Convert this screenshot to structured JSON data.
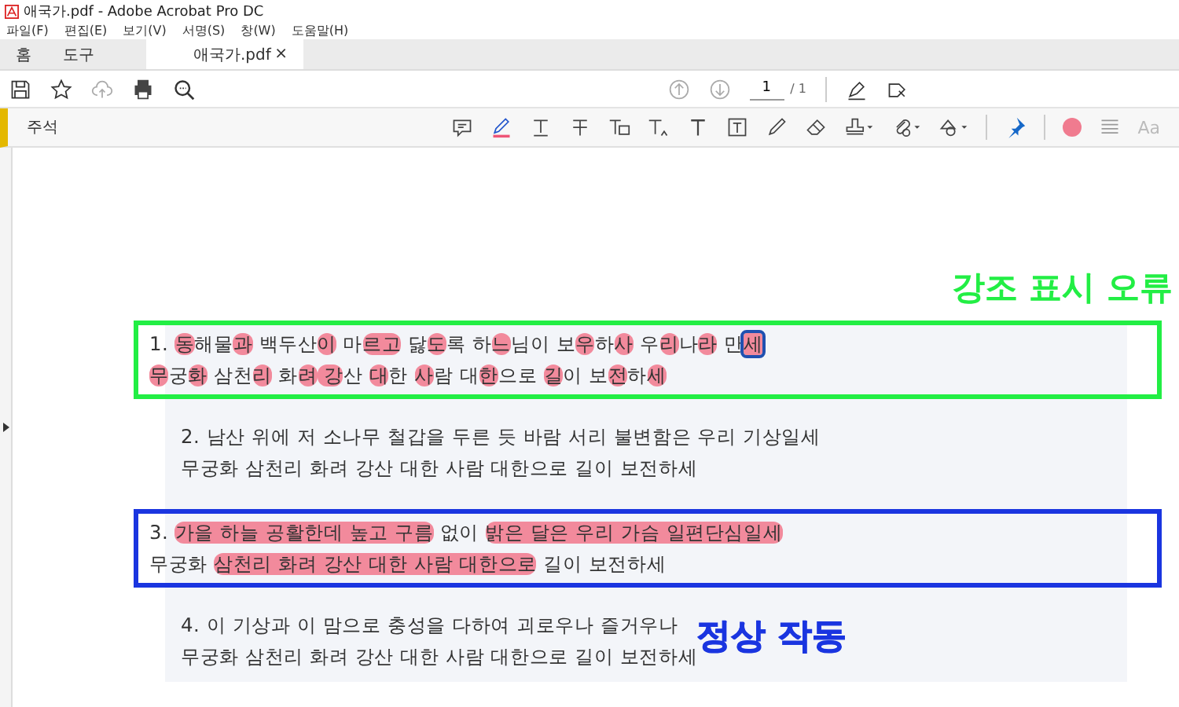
{
  "window": {
    "title": "애국가.pdf - Adobe Acrobat Pro DC"
  },
  "menu": [
    "파일(F)",
    "편집(E)",
    "보기(V)",
    "서명(S)",
    "창(W)",
    "도움말(H)"
  ],
  "tabs": [
    {
      "label": "홈",
      "selected": false
    },
    {
      "label": "도구",
      "selected": false
    },
    {
      "label": "애국가.pdf",
      "selected": true,
      "close": "×"
    }
  ],
  "page_nav": {
    "current": "1",
    "total": "/ 1"
  },
  "comment_bar": {
    "title": "주석",
    "font_label": "Aa"
  },
  "verses": [
    {
      "lines": [
        [
          {
            "t": "1. ",
            "kind": "plain"
          },
          {
            "t": "동",
            "kind": "hl"
          },
          {
            "t": "해물",
            "kind": "plain"
          },
          {
            "t": "과",
            "kind": "hl"
          },
          {
            "t": " 백두산",
            "kind": "plain"
          },
          {
            "t": "이",
            "kind": "hl"
          },
          {
            "t": " 마",
            "kind": "plain"
          },
          {
            "t": "르고",
            "kind": "hl"
          },
          {
            "t": " 닳",
            "kind": "plain"
          },
          {
            "t": "도",
            "kind": "hl"
          },
          {
            "t": "록 하",
            "kind": "plain"
          },
          {
            "t": "느",
            "kind": "hl"
          },
          {
            "t": "님이 보",
            "kind": "plain"
          },
          {
            "t": "우",
            "kind": "hl"
          },
          {
            "t": "하",
            "kind": "plain"
          },
          {
            "t": "사",
            "kind": "hl"
          },
          {
            "t": " 우",
            "kind": "plain"
          },
          {
            "t": "리",
            "kind": "hl"
          },
          {
            "t": "나",
            "kind": "plain"
          },
          {
            "t": "라",
            "kind": "hl"
          },
          {
            "t": " 만",
            "kind": "plain"
          },
          {
            "t": "세",
            "kind": "focus"
          }
        ],
        [
          {
            "t": "무",
            "kind": "hl"
          },
          {
            "t": "궁",
            "kind": "plain"
          },
          {
            "t": "화",
            "kind": "hl"
          },
          {
            "t": " 삼천",
            "kind": "plain"
          },
          {
            "t": "리",
            "kind": "hl"
          },
          {
            "t": " 화",
            "kind": "plain"
          },
          {
            "t": "려",
            "kind": "hl"
          },
          {
            "t": " 강",
            "kind": "hl"
          },
          {
            "t": "산 ",
            "kind": "plain"
          },
          {
            "t": "대",
            "kind": "hl"
          },
          {
            "t": "한 ",
            "kind": "plain"
          },
          {
            "t": "사",
            "kind": "hl"
          },
          {
            "t": "람 대",
            "kind": "plain"
          },
          {
            "t": "한",
            "kind": "hl"
          },
          {
            "t": "으로 ",
            "kind": "plain"
          },
          {
            "t": "길",
            "kind": "hl"
          },
          {
            "t": "이 보",
            "kind": "plain"
          },
          {
            "t": "전",
            "kind": "hl"
          },
          {
            "t": "하",
            "kind": "plain"
          },
          {
            "t": "세",
            "kind": "hl"
          }
        ]
      ],
      "annotation": {
        "text": "강조 표시 오류",
        "color": "#22ee44"
      }
    },
    {
      "lines": [
        [
          {
            "t": "2. 남산 위에 저 소나무 철갑을 두른 듯 바람 서리 불변함은 우리 기상일세",
            "kind": "plain"
          }
        ],
        [
          {
            "t": "무궁화 삼천리 화려 강산 대한 사람 대한으로 길이 보전하세",
            "kind": "plain"
          }
        ]
      ]
    },
    {
      "lines": [
        [
          {
            "t": "3. ",
            "kind": "plain"
          },
          {
            "t": "가을 하늘 공활한데 높고 구름",
            "kind": "hl"
          },
          {
            "t": " 없이 ",
            "kind": "plain"
          },
          {
            "t": "밝은 달은 우리 가슴 일편단심일세",
            "kind": "hl"
          }
        ],
        [
          {
            "t": "무궁화 ",
            "kind": "plain"
          },
          {
            "t": "삼천리 화려 강산 대한 사람 대한으로",
            "kind": "hl"
          },
          {
            "t": " 길이 보전하세",
            "kind": "plain"
          }
        ]
      ],
      "annotation": {
        "text": "정상 작동",
        "color": "#1a35e0"
      }
    },
    {
      "lines": [
        [
          {
            "t": "4. 이 기상과 이 맘으로 충성을 다하여 괴로우나 즐거우나",
            "kind": "plain"
          }
        ],
        [
          {
            "t": "무궁화 삼천리 화려 강산 대한 사람 대한으로 길이 보전하세",
            "kind": "plain"
          }
        ]
      ]
    }
  ]
}
